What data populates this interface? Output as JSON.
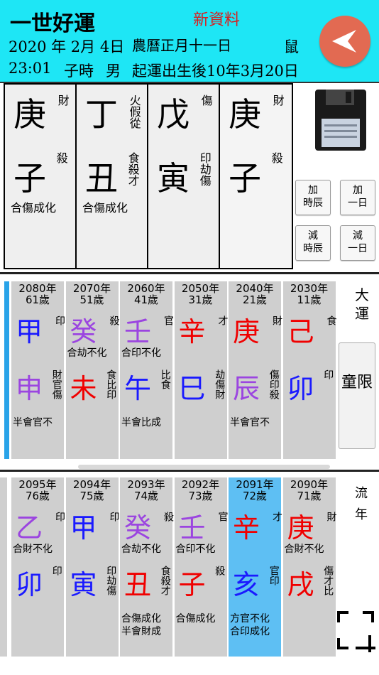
{
  "header": {
    "title": "一世好運",
    "new_data": "新資料",
    "birth_date": "2020 年 2月  4日",
    "lunar_date": "農曆正月十一日",
    "zodiac": "鼠",
    "birth_time": "23:01",
    "time_branch": "子時",
    "gender": "男",
    "start_luck": "起運出生後10年3月20日",
    "back_icon": "back-arrow-icon",
    "back_color": "#e26a52",
    "bg_color": "#1ee6f5"
  },
  "pillars": [
    {
      "stem": "庚",
      "stem_god": "財",
      "branch": "子",
      "hidden": "殺",
      "combo": "合傷成化"
    },
    {
      "stem": "丁",
      "stem_god": "火假從",
      "branch": "丑",
      "hidden": "食殺才",
      "combo": "合傷成化"
    },
    {
      "stem": "戊",
      "stem_god": "傷",
      "branch": "寅",
      "hidden": "印劫傷",
      "combo": ""
    },
    {
      "stem": "庚",
      "stem_god": "財",
      "branch": "子",
      "hidden": "殺",
      "combo": ""
    }
  ],
  "controls": {
    "save_icon": "floppy-disk-icon",
    "add_hour": "加\n時辰",
    "add_day": "加\n一日",
    "sub_hour": "減\n時辰",
    "sub_day": "減\n一日"
  },
  "luck": {
    "label": "大運",
    "childhood": "童限",
    "cards": [
      {
        "year": "2080年",
        "age": "61歲",
        "stem": "甲",
        "stem_color": "#1a1aff",
        "stem_god": "印",
        "stem_combo": "",
        "branch": "申",
        "branch_color": "#9b45e0",
        "branch_god": "財官傷",
        "branch_combo": "半會官不"
      },
      {
        "year": "2070年",
        "age": "51歲",
        "stem": "癸",
        "stem_color": "#9b45e0",
        "stem_god": "殺",
        "stem_combo": "合劫不化",
        "branch": "未",
        "branch_color": "#f00000",
        "branch_god": "食比印",
        "branch_combo": ""
      },
      {
        "year": "2060年",
        "age": "41歲",
        "stem": "壬",
        "stem_color": "#9b45e0",
        "stem_god": "官",
        "stem_combo": "合印不化",
        "branch": "午",
        "branch_color": "#1a1aff",
        "branch_god": "比食",
        "branch_combo": "半會比成"
      },
      {
        "year": "2050年",
        "age": "31歲",
        "stem": "辛",
        "stem_color": "#f00000",
        "stem_god": "才",
        "stem_combo": "",
        "branch": "巳",
        "branch_color": "#1a1aff",
        "branch_god": "劫傷財",
        "branch_combo": ""
      },
      {
        "year": "2040年",
        "age": "21歲",
        "stem": "庚",
        "stem_color": "#f00000",
        "stem_god": "財",
        "stem_combo": "",
        "branch": "辰",
        "branch_color": "#9b45e0",
        "branch_god": "傷印殺",
        "branch_combo": "半會官不"
      },
      {
        "year": "2030年",
        "age": "11歲",
        "stem": "己",
        "stem_color": "#f00000",
        "stem_god": "食",
        "stem_combo": "",
        "branch": "卯",
        "branch_color": "#1a1aff",
        "branch_god": "印",
        "branch_combo": ""
      }
    ]
  },
  "annual": {
    "label": "流年",
    "screenshot_icon": "crop-screenshot-icon",
    "cards": [
      {
        "year": "2095年",
        "age": "76歲",
        "stem": "乙",
        "stem_color": "#9b45e0",
        "stem_god": "印",
        "stem_combo": "合財不化",
        "branch": "卯",
        "branch_color": "#1a1aff",
        "branch_god": "印",
        "branch_combo": "",
        "active": false
      },
      {
        "year": "2094年",
        "age": "75歲",
        "stem": "甲",
        "stem_color": "#1a1aff",
        "stem_god": "印",
        "stem_combo": "",
        "branch": "寅",
        "branch_color": "#1a1aff",
        "branch_god": "印劫傷",
        "branch_combo": "",
        "active": false
      },
      {
        "year": "2093年",
        "age": "74歲",
        "stem": "癸",
        "stem_color": "#9b45e0",
        "stem_god": "殺",
        "stem_combo": "合劫不化",
        "branch": "丑",
        "branch_color": "#f00000",
        "branch_god": "食殺才",
        "branch_combo": "合傷成化\n半會財成",
        "active": false
      },
      {
        "year": "2092年",
        "age": "73歲",
        "stem": "壬",
        "stem_color": "#9b45e0",
        "stem_god": "官",
        "stem_combo": "合印不化",
        "branch": "子",
        "branch_color": "#f00000",
        "branch_god": "殺",
        "branch_combo": "合傷成化",
        "active": false
      },
      {
        "year": "2091年",
        "age": "72歲",
        "stem": "辛",
        "stem_color": "#f00000",
        "stem_god": "才",
        "stem_combo": "",
        "branch": "亥",
        "branch_color": "#1a1aff",
        "branch_god": "官印",
        "branch_combo": "方官不化\n合印成化",
        "active": true
      },
      {
        "year": "2090年",
        "age": "71歲",
        "stem": "庚",
        "stem_color": "#f00000",
        "stem_god": "財",
        "stem_combo": "合財不化",
        "branch": "戌",
        "branch_color": "#f00000",
        "branch_god": "傷才比",
        "branch_combo": "",
        "active": false
      }
    ]
  }
}
